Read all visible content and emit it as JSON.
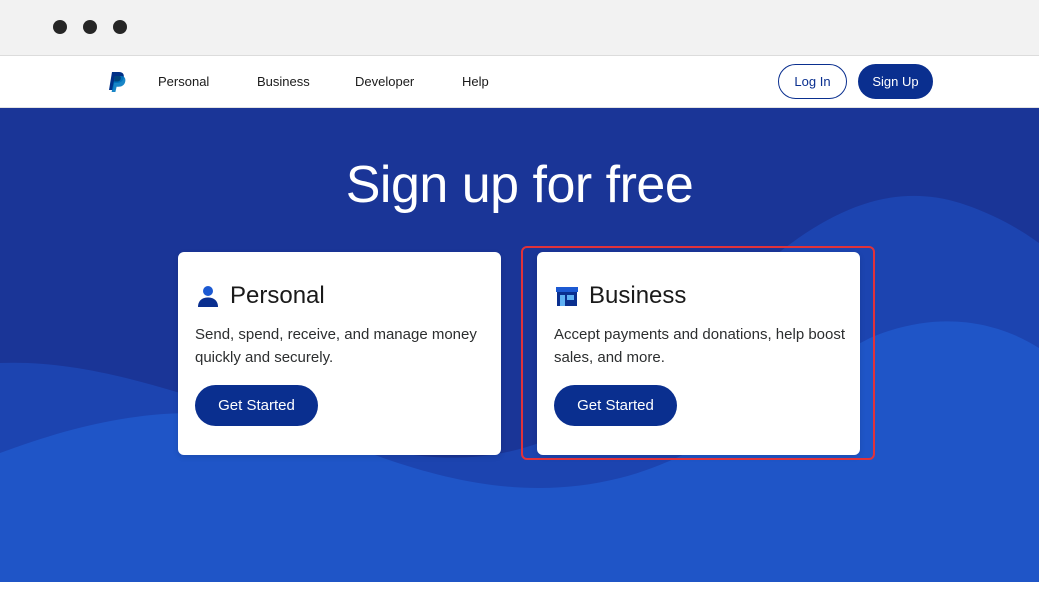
{
  "nav": {
    "logo_icon": "paypal-logo-icon",
    "links": [
      "Personal",
      "Business",
      "Developer",
      "Help"
    ],
    "login_label": "Log In",
    "signup_label": "Sign Up"
  },
  "hero": {
    "title": "Sign up for free"
  },
  "cards": [
    {
      "icon": "person-icon",
      "title": "Personal",
      "description": "Send, spend, receive, and manage money quickly and securely.",
      "button_label": "Get Started"
    },
    {
      "icon": "storefront-icon",
      "title": "Business",
      "description": "Accept payments and donations, help boost sales, and more.",
      "button_label": "Get Started"
    }
  ],
  "colors": {
    "brand_dark_blue": "#0a2f8f",
    "hero_background": "#1a3597",
    "wave_light": "#1f55c7",
    "highlight_red": "#e0323a"
  }
}
